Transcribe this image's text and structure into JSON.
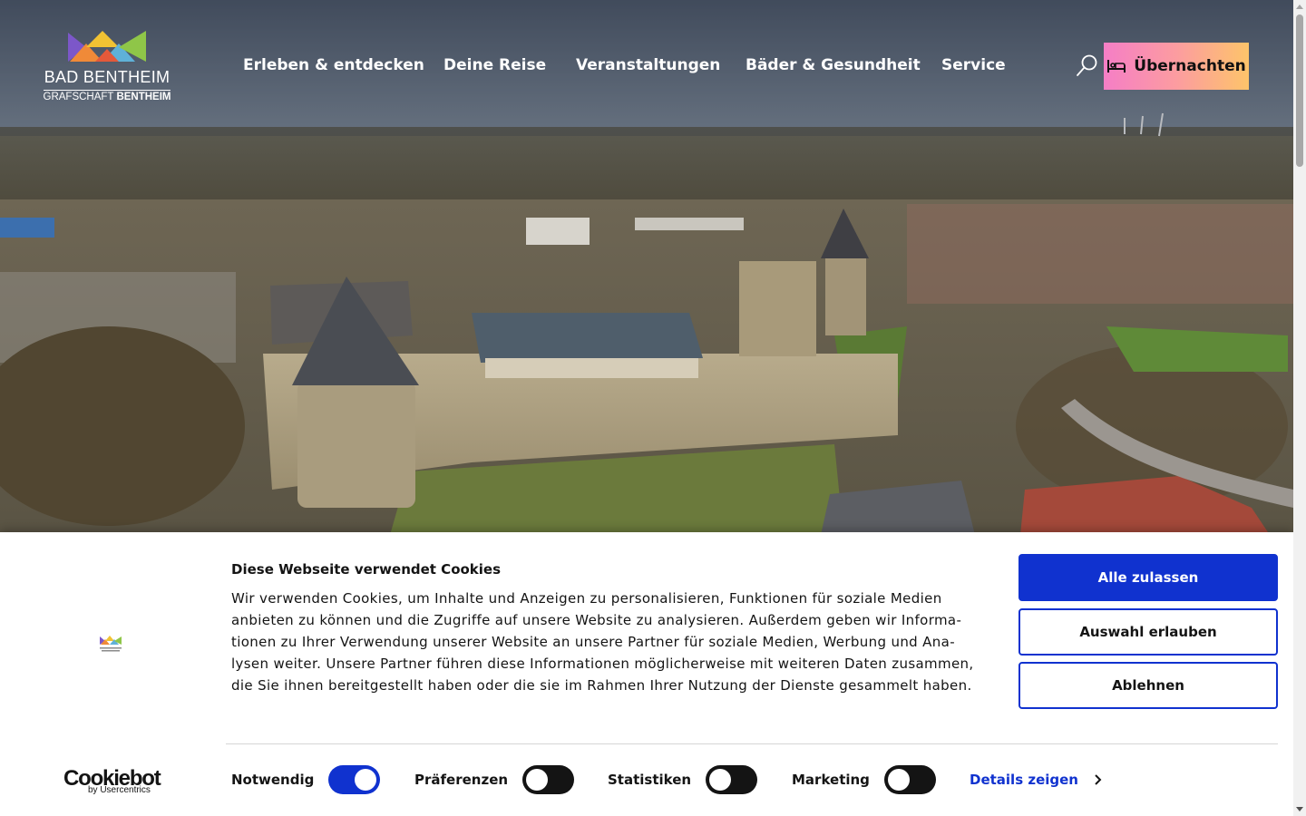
{
  "header": {
    "logo_title": "BAD BENTHEIM",
    "logo_sub_light": "GRAFSCHAFT ",
    "logo_sub_bold": "BENTHEIM",
    "nav": [
      {
        "label": "Erleben & entdecken"
      },
      {
        "label": "Deine Reise"
      },
      {
        "label": "Veranstaltungen"
      },
      {
        "label": "Bäder & Gesundheit"
      },
      {
        "label": "Service"
      }
    ],
    "search_icon": "search-icon",
    "stay_button": "Übernachten",
    "stay_icon": "bed-icon"
  },
  "cookie_banner": {
    "title": "Diese Webseite verwendet Cookies",
    "text": "Wir verwenden Cookies, um Inhalte und Anzeigen zu personalisieren, Funktionen für soziale Medien anbieten zu können und die Zugriffe auf unsere Website zu analysieren. Außerdem geben wir Informa­tionen zu Ihrer Verwendung unserer Website an unsere Partner für soziale Medien, Werbung und Ana­lysen weiter. Unsere Partner führen diese Informationen möglicherweise mit weiteren Daten zusam­men, die Sie ihnen bereitgestellt haben oder die sie im Rahmen Ihrer Nutzung der Dienste gesammelt haben.",
    "allow_all": "Alle zulassen",
    "allow_selection": "Auswahl erlauben",
    "deny": "Ablehnen",
    "brand_name": "Cookiebot",
    "brand_by": "by Usercentrics",
    "toggles": [
      {
        "label": "Notwendig",
        "on": true
      },
      {
        "label": "Präferenzen",
        "on": false
      },
      {
        "label": "Statistiken",
        "on": false
      },
      {
        "label": "Marketing",
        "on": false
      }
    ],
    "details_link": "Details zeigen"
  },
  "colors": {
    "primary_blue": "#1032cf",
    "stay_gradient_start": "#f57ec6",
    "stay_gradient_end": "#fdc46a"
  }
}
